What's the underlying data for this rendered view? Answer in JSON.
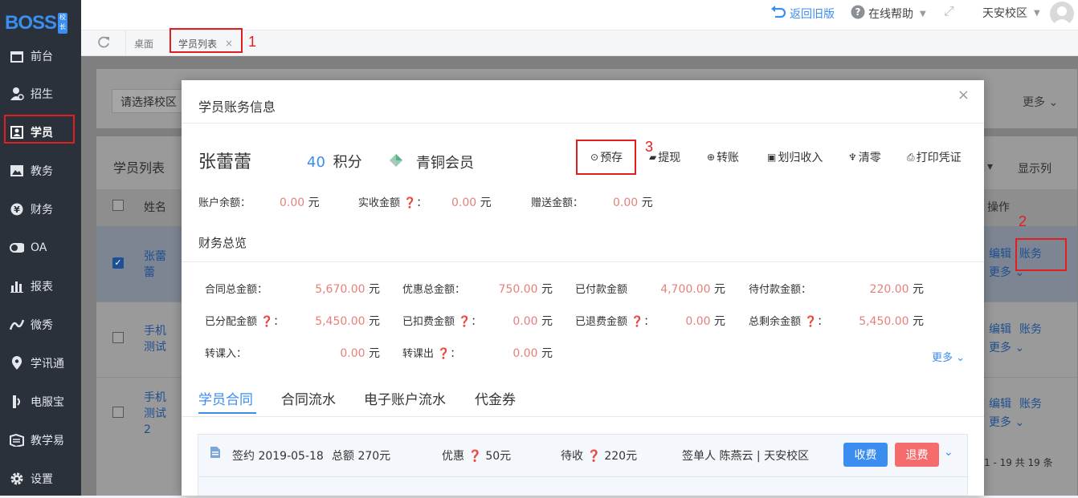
{
  "brand": {
    "logo": "BOSS",
    "logo_tag": "校长"
  },
  "sidebar": {
    "items": [
      {
        "label": "前台",
        "icon": "calendar-icon"
      },
      {
        "label": "招生",
        "icon": "user-plus-icon"
      },
      {
        "label": "学员",
        "icon": "student-icon"
      },
      {
        "label": "教务",
        "icon": "image-icon"
      },
      {
        "label": "财务",
        "icon": "yen-icon"
      },
      {
        "label": "OA",
        "icon": "toggle-icon"
      },
      {
        "label": "报表",
        "icon": "bar-chart-icon"
      },
      {
        "label": "微秀",
        "icon": "wave-icon"
      },
      {
        "label": "学讯通",
        "icon": "location-icon"
      },
      {
        "label": "电服宝",
        "icon": "phone-icon"
      },
      {
        "label": "教学易",
        "icon": "book-icon"
      },
      {
        "label": "设置",
        "icon": "gear-icon"
      }
    ]
  },
  "topbar": {
    "back_old": "返回旧版",
    "help": "在线帮助",
    "campus": "天安校区"
  },
  "tabs": [
    {
      "label": "桌面"
    },
    {
      "label": "学员列表"
    }
  ],
  "annotations": {
    "one": "1",
    "two": "2",
    "three": "3"
  },
  "background": {
    "select_campus": "请选择校区",
    "more": "更多",
    "list_title": "学员列表",
    "show_cols": "显示列",
    "col_name": "姓名",
    "col_ops": "操作",
    "rows": [
      {
        "name": "张蕾蕾",
        "edit": "编辑",
        "account": "账务",
        "more": "更多"
      },
      {
        "name": "手机测试",
        "edit": "编辑",
        "account": "账务",
        "more": "更多"
      },
      {
        "name": "手机测试2",
        "edit": "编辑",
        "account": "账务",
        "more": "更多"
      }
    ],
    "pagination": "1 - 19  共 19 条"
  },
  "modal": {
    "title": "学员账务信息",
    "close": "×",
    "student_name": "张蕾蕾",
    "points_value": "40",
    "points_unit": "积分",
    "member_level": "青铜会员",
    "actions": [
      "预存",
      "提现",
      "转账",
      "划归收入",
      "清零",
      "打印凭证"
    ],
    "balance": [
      {
        "label": "账户余额：",
        "value": "0.00",
        "unit": "元"
      },
      {
        "label": "实收金额",
        "value": "0.00",
        "unit": "元"
      },
      {
        "label": "赠送金额：",
        "value": "0.00",
        "unit": "元"
      }
    ],
    "overview_title": "财务总览",
    "overview": [
      {
        "label": "合同总金额：",
        "value": "5,670.00",
        "unit": "元"
      },
      {
        "label": "优惠总金额：",
        "value": "750.00",
        "unit": "元"
      },
      {
        "label": "已付款金额",
        "value": "4,700.00",
        "unit": "元"
      },
      {
        "label": "待付款金额：",
        "value": "220.00",
        "unit": "元"
      },
      {
        "label": "已分配金额",
        "value": "5,450.00",
        "unit": "元"
      },
      {
        "label": "已扣费金额",
        "value": "0.00",
        "unit": "元"
      },
      {
        "label": "已退费金额",
        "value": "0.00",
        "unit": "元"
      },
      {
        "label": "总剩余金额",
        "value": "5,450.00",
        "unit": "元"
      },
      {
        "label": "转课入：",
        "value": "0.00",
        "unit": "元"
      },
      {
        "label": "转课出",
        "value": "0.00",
        "unit": "元"
      }
    ],
    "more": "更多",
    "tabs": [
      "学员合同",
      "合同流水",
      "电子账户流水",
      "代金券"
    ],
    "contract": {
      "sign": "签约 2019-05-18",
      "total": "总额 270元",
      "discount_label": "优惠",
      "discount_value": "50元",
      "pending_label": "待收",
      "pending_value": "220元",
      "signer": "签单人 陈燕云 | 天安校区",
      "collect_btn": "收费",
      "refund_btn": "退费"
    }
  },
  "colors": {
    "accent": "#3b8ef0",
    "danger": "#f56c6c",
    "value_red": "#e8807a",
    "sidebar_bg": "#2b313a",
    "annotation": "#e02020"
  }
}
